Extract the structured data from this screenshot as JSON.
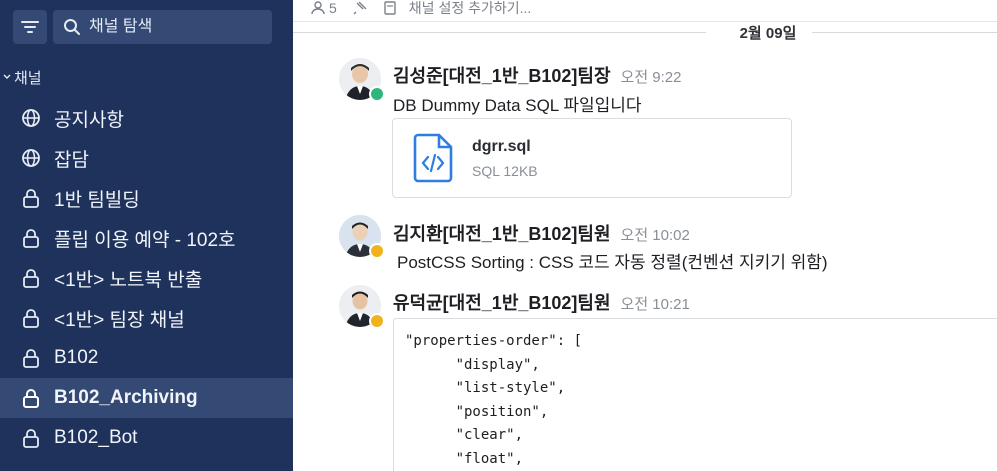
{
  "sidebar": {
    "search_placeholder": "채널 탐색",
    "section_label": "채널",
    "channels": [
      {
        "label": "공지사항",
        "icon": "globe-icon",
        "active": false
      },
      {
        "label": "잡담",
        "icon": "globe-icon",
        "active": false
      },
      {
        "label": "1반 팀빌딩",
        "icon": "lock-icon",
        "active": false
      },
      {
        "label": "플립 이용 예약 - 102호",
        "icon": "lock-icon",
        "active": false
      },
      {
        "label": "<1반> 노트북 반출",
        "icon": "lock-icon",
        "active": false
      },
      {
        "label": "<1반> 팀장 채널",
        "icon": "lock-icon",
        "active": false
      },
      {
        "label": "B102",
        "icon": "lock-icon",
        "active": false
      },
      {
        "label": "B102_Archiving",
        "icon": "lock-icon",
        "active": true
      },
      {
        "label": "B102_Bot",
        "icon": "lock-icon",
        "active": false
      }
    ]
  },
  "topbar": {
    "member_count": "5",
    "header_placeholder": "채널 설정 추가하기..."
  },
  "date_divider": "2월 09일",
  "messages": [
    {
      "sender": "김성준[대전_1반_B102]팀장",
      "time": "오전 9:22",
      "text": "DB Dummy Data SQL 파일입니다",
      "status": "online",
      "attachment": {
        "name": "dgrr.sql",
        "meta": "SQL 12KB"
      }
    },
    {
      "sender": "김지환[대전_1반_B102]팀원",
      "time": "오전 10:02",
      "text": "PostCSS Sorting : CSS 코드 자동 정렬(컨벤션 지키기 위함)",
      "status": "away"
    },
    {
      "sender": "유덕균[대전_1반_B102]팀원",
      "time": "오전 10:21",
      "status": "away",
      "code_lines": [
        "\"properties-order\": [",
        "      \"display\",",
        "      \"list-style\",",
        "      \"position\",",
        "      \"clear\",",
        "      \"float\","
      ]
    }
  ],
  "colors": {
    "sidebar_bg": "#1e325c",
    "sidebar_active": "#344a75",
    "online": "#2eb67d",
    "away": "#f2b21b",
    "file_icon": "#2f7de1"
  }
}
